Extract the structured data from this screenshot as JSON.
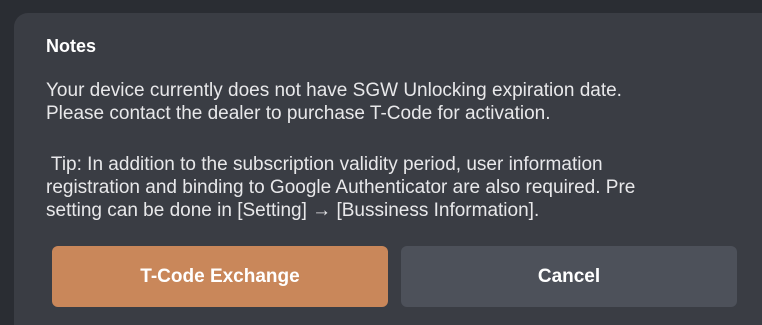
{
  "dialog": {
    "title": "Notes",
    "message_lines": [
      "Your device currently does not have SGW Unlocking expiration date.",
      "Please contact the dealer to purchase T-Code for activation."
    ],
    "tip_lines": [
      " Tip: In addition to the subscription validity period, user information",
      "registration and binding to Google Authenticator are also required. Pre",
      "setting can be done in [Setting] → [Bussiness Information]."
    ],
    "primary_button": "T-Code Exchange",
    "secondary_button": "Cancel"
  },
  "colors": {
    "primary": "#c9875a",
    "secondary": "#4d515a",
    "dialog_bg": "#3a3d44"
  }
}
